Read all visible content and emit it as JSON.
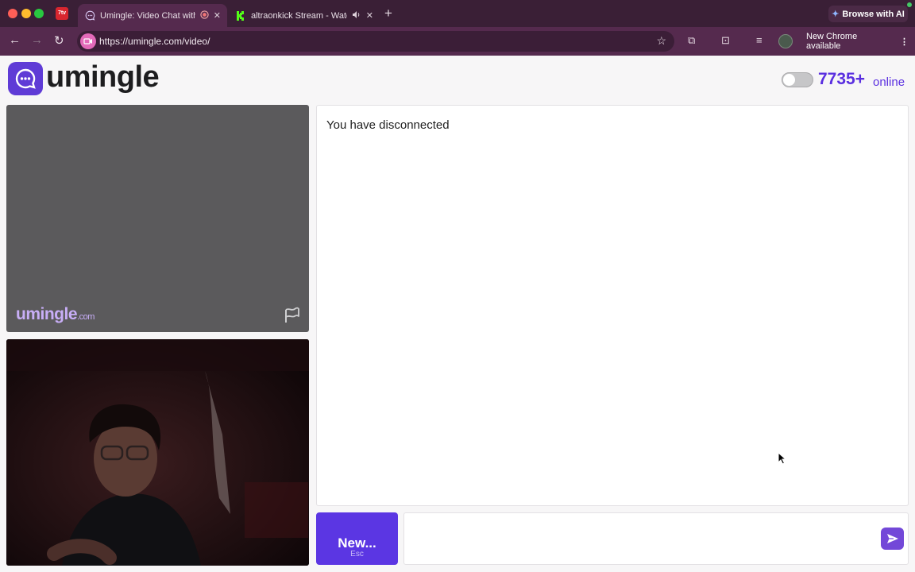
{
  "browser": {
    "pinned_tab_label": "7tv",
    "tabs": [
      {
        "title": "Umingle: Video Chat with",
        "active": true
      },
      {
        "title": "altraonkick Stream - Watc",
        "active": false
      }
    ],
    "browse_ai_label": "Browse with AI",
    "url": "https://umingle.com/video/",
    "update_label": "New Chrome available"
  },
  "header": {
    "logo_text": "umingle",
    "online_count": "7735+",
    "online_label": "online"
  },
  "video": {
    "watermark": "umingle",
    "watermark_suffix": ".com"
  },
  "chat": {
    "status_message": "You have disconnected",
    "new_button_label": "New...",
    "new_button_hint": "Esc",
    "message_input_value": ""
  },
  "colors": {
    "brand": "#5b36e3",
    "online_text": "#5a2fe0",
    "tabbar": "#3a1f36",
    "toolbar": "#552a4e"
  },
  "icons": [
    "chat-bubble-icon",
    "record-icon",
    "speaker-icon",
    "kick-icon",
    "flag-icon",
    "send-icon",
    "star-icon"
  ]
}
